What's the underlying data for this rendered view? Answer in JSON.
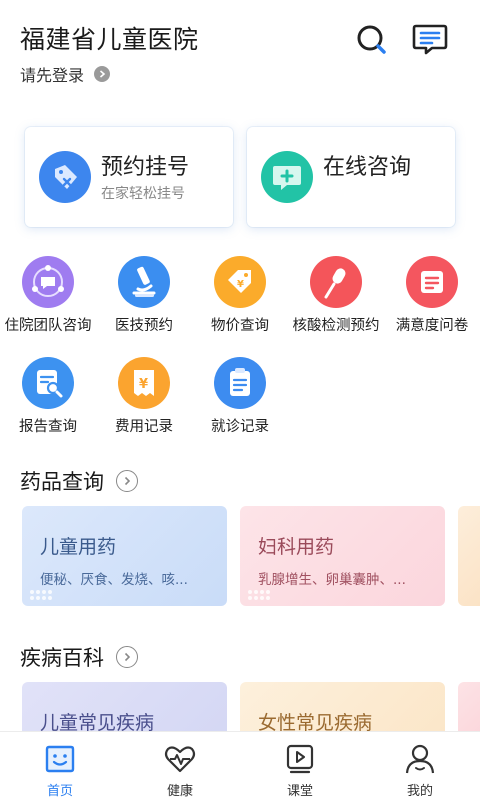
{
  "header": {
    "title": "福建省儿童医院",
    "login_prompt": "请先登录"
  },
  "main_cards": [
    {
      "title": "预约挂号",
      "subtitle": "在家轻松挂号",
      "icon": "tag-icon",
      "color": "#3d86ee"
    },
    {
      "title": "在线咨询",
      "subtitle": "",
      "icon": "chat-plus-icon",
      "color": "#22c3a6"
    }
  ],
  "services": [
    {
      "label": "住院团队咨询",
      "icon": "team-chat-icon",
      "color": "#9f7cf0"
    },
    {
      "label": "医技预约",
      "icon": "microscope-icon",
      "color": "#3b8ef0"
    },
    {
      "label": "物价查询",
      "icon": "price-tag-icon",
      "color": "#fbab2b"
    },
    {
      "label": "核酸检测预约",
      "icon": "swab-icon",
      "color": "#f4555a"
    },
    {
      "label": "满意度问卷",
      "icon": "questionnaire-icon",
      "color": "#f4565f"
    },
    {
      "label": "报告查询",
      "icon": "report-search-icon",
      "color": "#3d92f0"
    },
    {
      "label": "费用记录",
      "icon": "bill-icon",
      "color": "#fba42f"
    },
    {
      "label": "就诊记录",
      "icon": "clipboard-icon",
      "color": "#3d8cf0"
    }
  ],
  "drug_section": {
    "title": "药品查询",
    "cards": [
      {
        "name": "儿童用药",
        "desc": "便秘、厌食、发烧、咳...",
        "theme": "blue"
      },
      {
        "name": "妇科用药",
        "desc": "乳腺增生、卵巢囊肿、...",
        "theme": "pink"
      }
    ]
  },
  "disease_section": {
    "title": "疾病百科",
    "cards": [
      {
        "name": "儿童常见疾病",
        "theme": "purple"
      },
      {
        "name": "女性常见疾病",
        "theme": "orange"
      }
    ]
  },
  "bottom_nav": [
    {
      "label": "首页",
      "active": true
    },
    {
      "label": "健康",
      "active": false
    },
    {
      "label": "课堂",
      "active": false
    },
    {
      "label": "我的",
      "active": false
    }
  ]
}
